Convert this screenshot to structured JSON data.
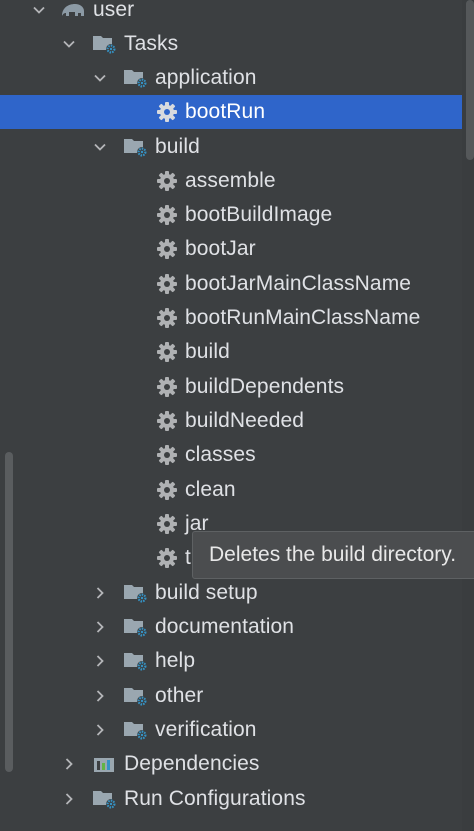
{
  "tree": {
    "project": {
      "label": "user"
    },
    "tasks": {
      "label": "Tasks",
      "application": {
        "label": "application",
        "items": [
          "bootRun"
        ]
      },
      "build": {
        "label": "build",
        "items": [
          "assemble",
          "bootBuildImage",
          "bootJar",
          "bootJarMainClassName",
          "bootRunMainClassName",
          "build",
          "buildDependents",
          "buildNeeded",
          "classes",
          "clean",
          "jar",
          "t"
        ]
      },
      "groups": [
        "build setup",
        "documentation",
        "help",
        "other",
        "verification"
      ]
    },
    "dependencies": {
      "label": "Dependencies"
    },
    "run_configurations": {
      "label": "Run Configurations"
    }
  },
  "tooltip": {
    "text": "Deletes the build directory."
  },
  "colors": {
    "background": "#3c3f41",
    "selection": "#2f65ca",
    "text": "#dfe1e5",
    "gear": "#afb1b3",
    "folder": "#9aa7b0",
    "gear_badge": "#3592c4"
  }
}
